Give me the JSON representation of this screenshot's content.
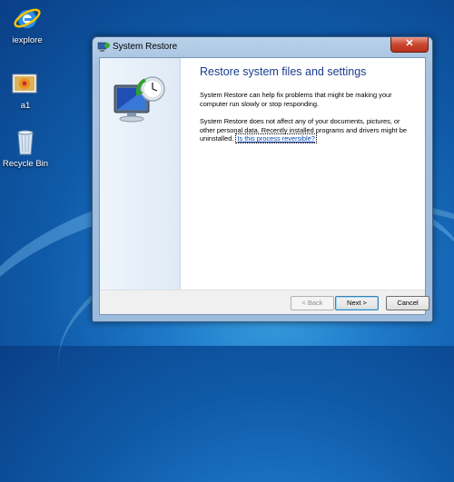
{
  "desktop": {
    "icons": [
      {
        "label": "iexplore",
        "icon": "internet-explorer-icon"
      },
      {
        "label": "a1",
        "icon": "image-file-icon"
      },
      {
        "label": "Recycle Bin",
        "icon": "recycle-bin-icon"
      }
    ]
  },
  "window": {
    "title": "System Restore",
    "close_label": "✕",
    "heading": "Restore system files and settings",
    "para1": "System Restore can help fix problems that might be making your computer run slowly or stop responding.",
    "para2": "System Restore does not affect any of your documents, pictures, or other personal data. Recently installed programs and drivers might be uninstalled.",
    "link": "Is this process reversible?",
    "buttons": {
      "back": "< Back",
      "next": "Next >",
      "cancel": "Cancel"
    }
  }
}
